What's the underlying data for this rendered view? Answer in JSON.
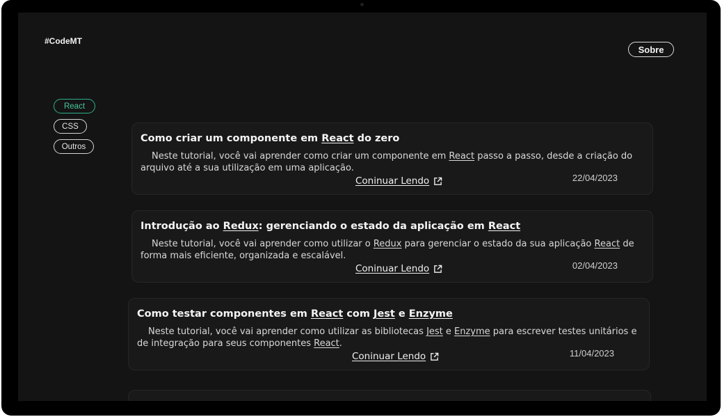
{
  "header": {
    "brand": "#CodeMT",
    "about_label": "Sobre"
  },
  "tags": [
    "React",
    "CSS",
    "Outros"
  ],
  "active_tag": "React",
  "posts": [
    {
      "title_parts": [
        "Como criar um componente em ",
        "React",
        " do zero"
      ],
      "text_parts": [
        "Neste tutorial, você vai aprender como criar um componente em ",
        "React",
        " passo a passo, desde a criação do arquivo até a sua utilização em uma aplicação."
      ],
      "read_more": "Coninuar Lendo",
      "date": "22/04/2023"
    },
    {
      "title_parts": [
        "Introdução ao ",
        "Redux",
        ": gerenciando o estado da aplicação em ",
        "React",
        ""
      ],
      "text_parts": [
        "Neste tutorial, você vai aprender como utilizar o ",
        "Redux",
        " para gerenciar o estado da sua aplicação ",
        "React",
        " de forma mais eficiente, organizada e escalável."
      ],
      "read_more": "Coninuar Lendo",
      "date": "02/04/2023"
    },
    {
      "title_parts": [
        "Como testar componentes em ",
        "React",
        " com ",
        "Jest",
        " e ",
        "Enzyme",
        ""
      ],
      "text_parts": [
        "Neste tutorial, você vai aprender como utilizar as bibliotecas ",
        "Jest",
        " e ",
        "Enzyme",
        " para escrever testes unitários e de integração para seus componentes ",
        "React",
        "."
      ],
      "read_more": "Coninuar Lendo",
      "date": "11/04/2023"
    }
  ],
  "colors": {
    "background": "#141414",
    "card": "#191919",
    "accent": "#2fb08b"
  },
  "icons": {
    "read_more": "external-link-icon"
  }
}
